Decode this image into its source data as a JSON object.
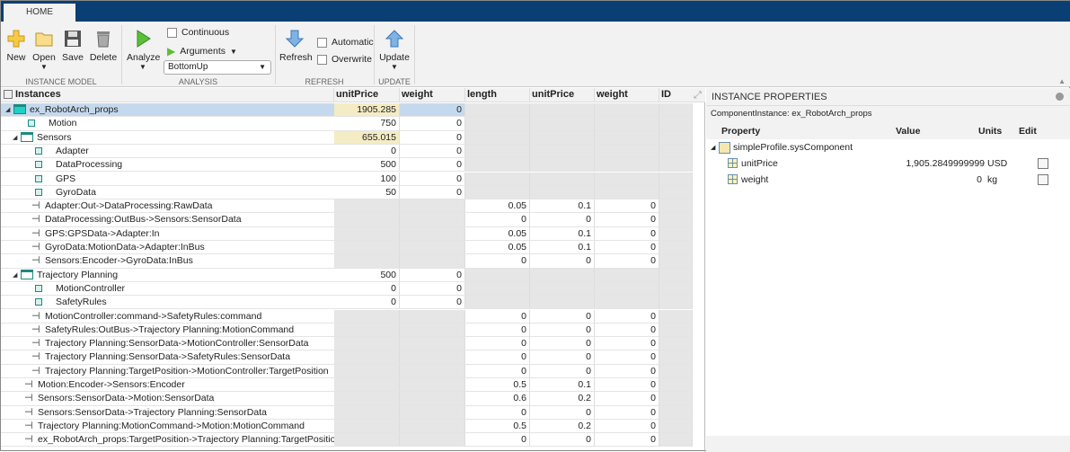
{
  "tabs": [
    "HOME"
  ],
  "ribbon": {
    "instance_model": {
      "label": "INSTANCE MODEL",
      "new": "New",
      "open": "Open",
      "save": "Save",
      "delete": "Delete"
    },
    "analysis": {
      "label": "ANALYSIS",
      "analyze": "Analyze",
      "continuous": "Continuous",
      "continuous_checked": false,
      "arguments": "Arguments",
      "strategy": "BottomUp"
    },
    "refresh": {
      "label": "REFRESH",
      "refresh": "Refresh",
      "automatic": "Automatic",
      "automatic_checked": false,
      "overwrite": "Overwrite",
      "overwrite_checked": false
    },
    "update": {
      "label": "UPDATE",
      "update": "Update"
    }
  },
  "table": {
    "headers": [
      "Instances",
      "unitPrice",
      "weight",
      "length",
      "unitPrice",
      "weight",
      "ID"
    ],
    "rows": [
      {
        "name": "ex_RobotArch_props",
        "type": "root",
        "level": 0,
        "expanded": true,
        "selected": true,
        "unitPrice": "1905.285",
        "weight": "0",
        "computed": true
      },
      {
        "name": "Motion",
        "type": "component",
        "level": 1,
        "unitPrice": "750",
        "weight": "0"
      },
      {
        "name": "Sensors",
        "type": "folder",
        "level": 1,
        "expanded": true,
        "unitPrice": "655.015",
        "weight": "0",
        "computed": true
      },
      {
        "name": "Adapter",
        "type": "component",
        "level": 2,
        "unitPrice": "0",
        "weight": "0"
      },
      {
        "name": "DataProcessing",
        "type": "component",
        "level": 2,
        "unitPrice": "500",
        "weight": "0"
      },
      {
        "name": "GPS",
        "type": "component",
        "level": 2,
        "unitPrice": "100",
        "weight": "0"
      },
      {
        "name": "GyroData",
        "type": "component",
        "level": 2,
        "unitPrice": "50",
        "weight": "0"
      },
      {
        "name": "Adapter:Out->DataProcessing:RawData",
        "type": "connector",
        "level": 2,
        "length": "0.05",
        "unitPrice": "0.1",
        "weight": "0"
      },
      {
        "name": "DataProcessing:OutBus->Sensors:SensorData",
        "type": "connector",
        "level": 2,
        "length": "0",
        "unitPrice": "0",
        "weight": "0"
      },
      {
        "name": "GPS:GPSData->Adapter:In",
        "type": "connector",
        "level": 2,
        "length": "0.05",
        "unitPrice": "0.1",
        "weight": "0"
      },
      {
        "name": "GyroData:MotionData->Adapter:InBus",
        "type": "connector",
        "level": 2,
        "length": "0.05",
        "unitPrice": "0.1",
        "weight": "0"
      },
      {
        "name": "Sensors:Encoder->GyroData:InBus",
        "type": "connector",
        "level": 2,
        "length": "0",
        "unitPrice": "0",
        "weight": "0"
      },
      {
        "name": "Trajectory Planning",
        "type": "folder",
        "level": 1,
        "expanded": true,
        "unitPrice": "500",
        "weight": "0"
      },
      {
        "name": "MotionController",
        "type": "component",
        "level": 2,
        "unitPrice": "0",
        "weight": "0"
      },
      {
        "name": "SafetyRules",
        "type": "component",
        "level": 2,
        "unitPrice": "0",
        "weight": "0"
      },
      {
        "name": "MotionController:command->SafetyRules:command",
        "type": "connector",
        "level": 2,
        "length": "0",
        "unitPrice": "0",
        "weight": "0"
      },
      {
        "name": "SafetyRules:OutBus->Trajectory Planning:MotionCommand",
        "type": "connector",
        "level": 2,
        "length": "0",
        "unitPrice": "0",
        "weight": "0"
      },
      {
        "name": "Trajectory Planning:SensorData->MotionController:SensorData",
        "type": "connector",
        "level": 2,
        "length": "0",
        "unitPrice": "0",
        "weight": "0"
      },
      {
        "name": "Trajectory Planning:SensorData->SafetyRules:SensorData",
        "type": "connector",
        "level": 2,
        "length": "0",
        "unitPrice": "0",
        "weight": "0"
      },
      {
        "name": "Trajectory Planning:TargetPosition->MotionController:TargetPosition",
        "type": "connector",
        "level": 2,
        "length": "0",
        "unitPrice": "0",
        "weight": "0"
      },
      {
        "name": "Motion:Encoder->Sensors:Encoder",
        "type": "connector",
        "level": 1,
        "length": "0.5",
        "unitPrice": "0.1",
        "weight": "0"
      },
      {
        "name": "Sensors:SensorData->Motion:SensorData",
        "type": "connector",
        "level": 1,
        "length": "0.6",
        "unitPrice": "0.2",
        "weight": "0"
      },
      {
        "name": "Sensors:SensorData->Trajectory Planning:SensorData",
        "type": "connector",
        "level": 1,
        "length": "0",
        "unitPrice": "0",
        "weight": "0"
      },
      {
        "name": "Trajectory Planning:MotionCommand->Motion:MotionCommand",
        "type": "connector",
        "level": 1,
        "length": "0.5",
        "unitPrice": "0.2",
        "weight": "0"
      },
      {
        "name": "ex_RobotArch_props:TargetPosition->Trajectory Planning:TargetPosition",
        "type": "connector",
        "level": 1,
        "length": "0",
        "unitPrice": "0",
        "weight": "0"
      }
    ]
  },
  "properties": {
    "title": "INSTANCE PROPERTIES",
    "instance": "ComponentInstance: ex_RobotArch_props",
    "headers": {
      "property": "Property",
      "value": "Value",
      "units": "Units",
      "edit": "Edit"
    },
    "profile": "simpleProfile.sysComponent",
    "items": [
      {
        "name": "unitPrice",
        "value": "1,905.2849999999",
        "units": "USD"
      },
      {
        "name": "weight",
        "value": "0",
        "units": "kg"
      }
    ]
  },
  "colors": {
    "titlebar": "#0a3f73",
    "selected_row": "#c5d9ee",
    "computed_cell": "#f4ecc4",
    "disabled_cell": "#e6e6e6"
  }
}
